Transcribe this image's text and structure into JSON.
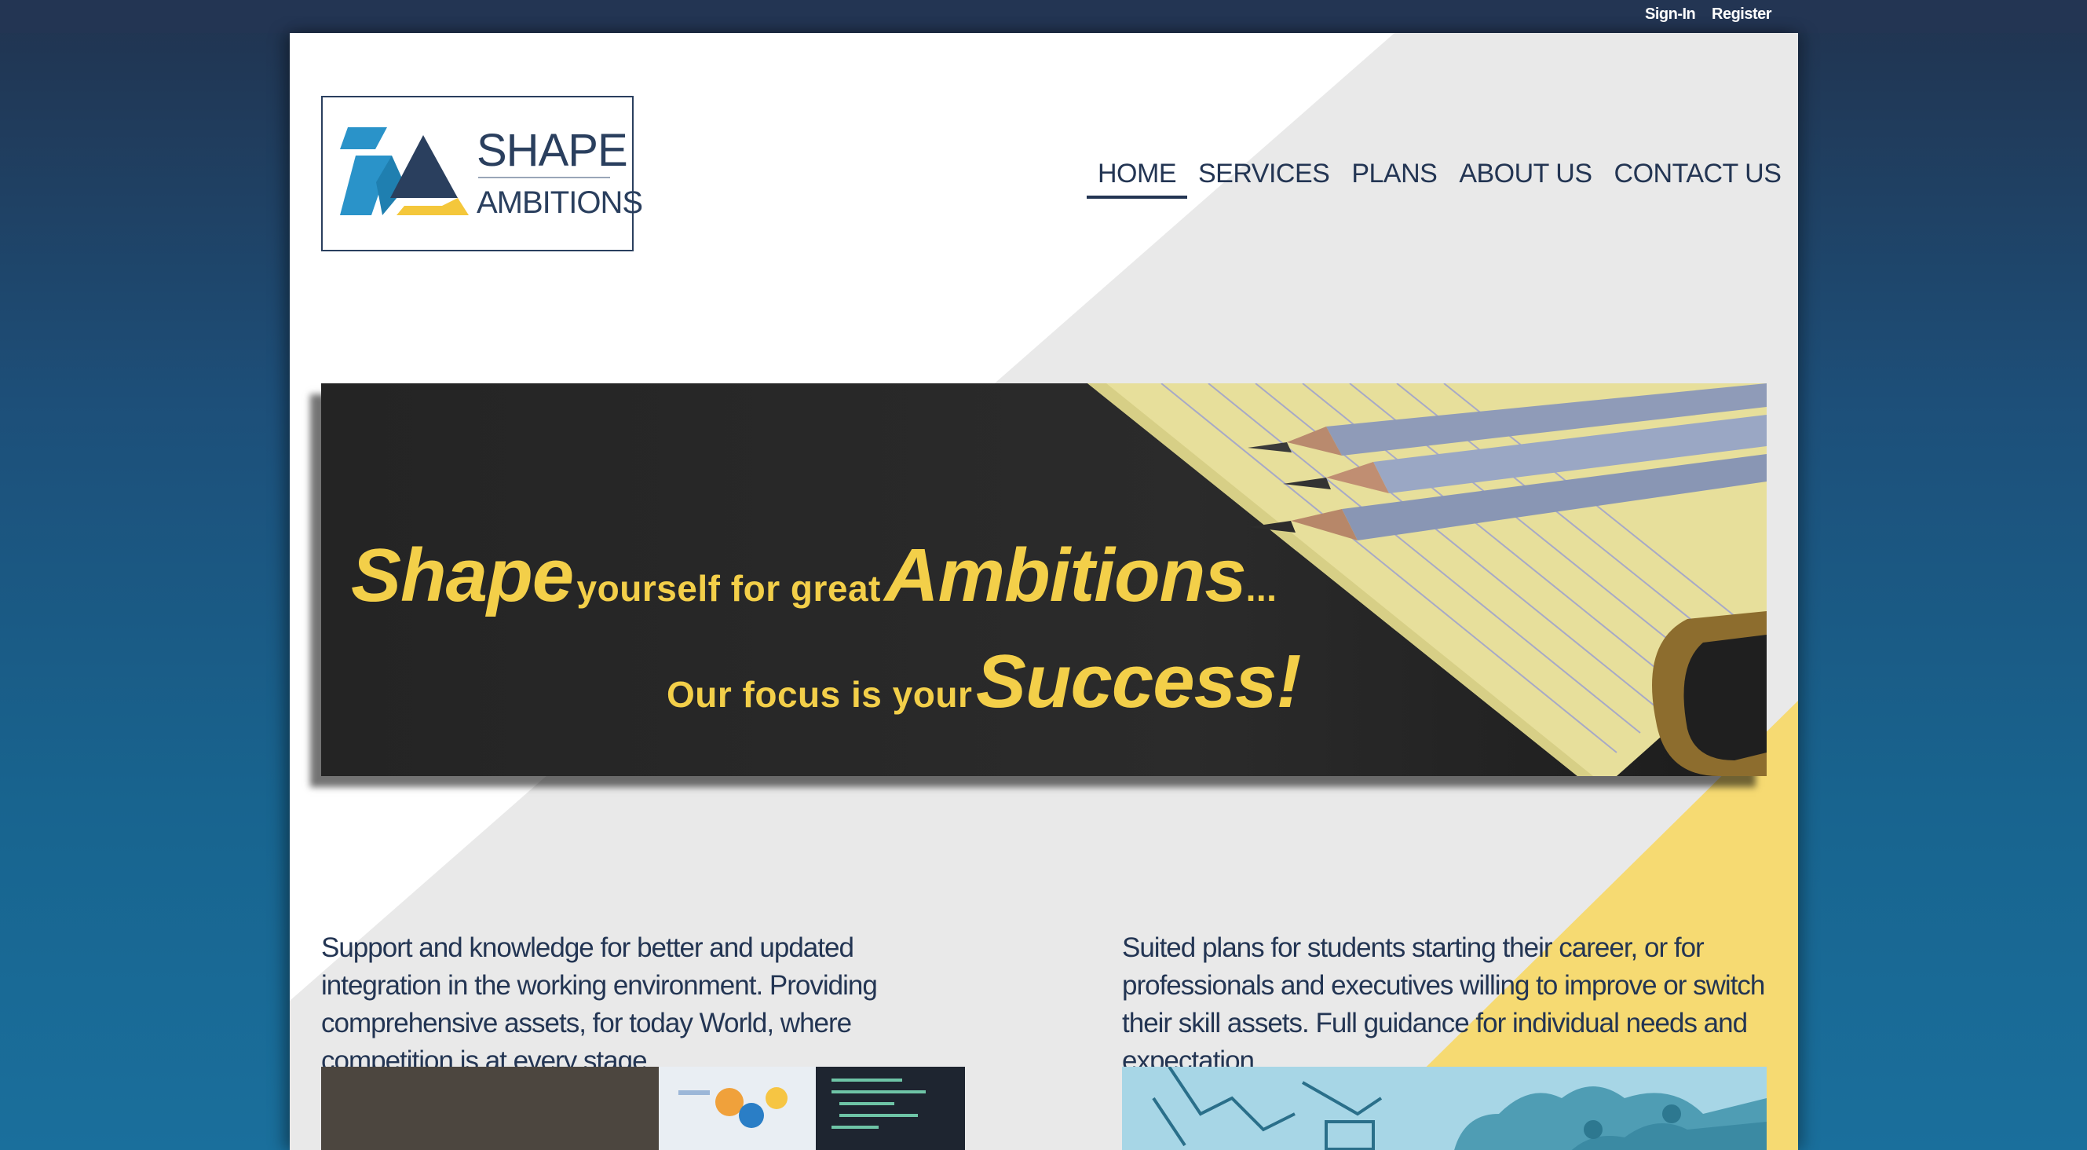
{
  "auth": {
    "sign_in": "Sign-In",
    "register": "Register"
  },
  "logo": {
    "line1": "SHAPE",
    "line2": "AMBITIONS"
  },
  "nav": {
    "items": [
      {
        "label": "HOME",
        "active": true
      },
      {
        "label": "SERVICES",
        "active": false
      },
      {
        "label": "PLANS",
        "active": false
      },
      {
        "label": "ABOUT US",
        "active": false
      },
      {
        "label": "CONTACT US",
        "active": false
      }
    ]
  },
  "hero": {
    "line1": {
      "word1": "Shape",
      "middle": "yourself for great",
      "word2": "Ambitions",
      "ellipsis": "..."
    },
    "line2": {
      "lead": "Our focus is your",
      "word": "Success!"
    }
  },
  "features": {
    "left": {
      "text": "Support and knowledge for better and updated integration in the working environment. Providing comprehensive assets, for today World, where competition is at every stage.",
      "image": "laptop-analytics-photo"
    },
    "right": {
      "text": "Suited plans for students starting their career, or for professionals and executives willing to improve or switch their skill assets. Full guidance for individual needs and expectation.",
      "image": "puzzle-pieces-photo"
    }
  },
  "colors": {
    "navy": "#233553",
    "accent_yellow": "#f3cf49",
    "logo_blue": "#2a93c9",
    "logo_yellow": "#f4c73b"
  }
}
